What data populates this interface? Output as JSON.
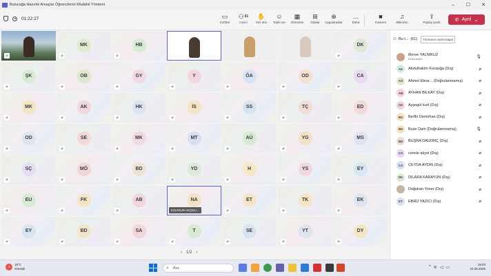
{
  "window": {
    "title": "Bulucağa Hazırlık Amaçlar Öğrencilerin Müdahil Yöntemi"
  },
  "toolbar": {
    "timer": "01:22:27",
    "buttons": [
      {
        "label": "Sohbet",
        "icon": "chat-icon"
      },
      {
        "label": "Kişiler",
        "icon": "people-icon",
        "count": "61"
      },
      {
        "label": "Söz alın",
        "icon": "raise-hand-icon"
      },
      {
        "label": "Tepki ver",
        "icon": "react-icon"
      },
      {
        "label": "Görünüm",
        "icon": "view-icon"
      },
      {
        "label": "Odalar",
        "icon": "rooms-icon"
      },
      {
        "label": "Uygulamalar",
        "icon": "apps-icon"
      },
      {
        "label": "Daha",
        "icon": "more-icon"
      },
      {
        "label": "Kamera",
        "icon": "camera-icon"
      },
      {
        "label": "Mikrofon",
        "icon": "mic-icon"
      },
      {
        "label": "Paylaş içerik",
        "icon": "share-icon"
      }
    ],
    "leave_label": "Ayrıl"
  },
  "grid": {
    "tiles": [
      {
        "initials": "MK",
        "color": "#dfead0"
      },
      {
        "initials": "HB",
        "color": "#d6ebd4"
      },
      {
        "initials": "DK",
        "color": "#dbe9d6"
      },
      {
        "initials": "ŞK",
        "color": "#d8ecd4"
      },
      {
        "initials": "OB",
        "color": "#dfe8cc"
      },
      {
        "initials": "GY",
        "color": "#f2d9e4"
      },
      {
        "initials": "Y",
        "color": "#f4d6df"
      },
      {
        "initials": "ÖA",
        "color": "#d7e3f4"
      },
      {
        "initials": "OD",
        "color": "#f3e0cf"
      },
      {
        "initials": "CA",
        "color": "#ead9f2"
      },
      {
        "initials": "MK",
        "color": "#f4e6c4"
      },
      {
        "initials": "AK",
        "color": "#f2d6dc"
      },
      {
        "initials": "HK",
        "color": "#dde3f3"
      },
      {
        "initials": "İS",
        "color": "#f6e6c6"
      },
      {
        "initials": "SS",
        "color": "#d7e2f3"
      },
      {
        "initials": "TÇ",
        "color": "#f3dcd4"
      },
      {
        "initials": "ED",
        "color": "#f3d8dc"
      },
      {
        "initials": "OD",
        "color": "#dde5ee"
      },
      {
        "initials": "SE",
        "color": "#f4dad6"
      },
      {
        "initials": "MK",
        "color": "#f0d9e2"
      },
      {
        "initials": "MT",
        "color": "#d6e0f3"
      },
      {
        "initials": "AÜ",
        "color": "#d8ead6"
      },
      {
        "initials": "YG",
        "color": "#f4e2c8"
      },
      {
        "initials": "MS",
        "color": "#e0e4f2"
      },
      {
        "initials": "SÇ",
        "color": "#e6dcf3"
      },
      {
        "initials": "MÖ",
        "color": "#f2d6d8"
      },
      {
        "initials": "BD",
        "color": "#eee2d2"
      },
      {
        "initials": "YD",
        "color": "#dceadb"
      },
      {
        "initials": "H",
        "color": "#f5e8c6"
      },
      {
        "initials": "YS",
        "color": "#f2d7e0"
      },
      {
        "initials": "EY",
        "color": "#d8e6f3"
      },
      {
        "initials": "EU",
        "color": "#d7ead6"
      },
      {
        "initials": "FK",
        "color": "#f5e4c6"
      },
      {
        "initials": "AB",
        "color": "#f1d6dd"
      },
      {
        "initials": "NA",
        "color": "#f4e2c6"
      },
      {
        "initials": "ET",
        "color": "#f4e4c8"
      },
      {
        "initials": "TK",
        "color": "#f5e6c6"
      },
      {
        "initials": "EK",
        "color": "#dce3f2"
      },
      {
        "initials": "EY",
        "color": "#d7e6f3"
      },
      {
        "initials": "BD",
        "color": "#f4e4c8"
      },
      {
        "initials": "SA",
        "color": "#f2d6dc"
      },
      {
        "initials": "T",
        "color": "#d9ead4"
      },
      {
        "initials": "SE",
        "color": "#d8e4f3"
      },
      {
        "initials": "YT",
        "color": "#dde4f2"
      },
      {
        "initials": "DY",
        "color": "#f5e6c6"
      }
    ],
    "speaking_name": "KISANUR AKÇELI...",
    "page": "1/2"
  },
  "panel": {
    "title": "Bu t...",
    "count": "(61)",
    "search_label": "Tümünün sesini kapat",
    "participants": [
      {
        "initials": "",
        "name": "Merve YALNIKUZ",
        "sub": "Düzenleyici",
        "color": "#c9a48a",
        "mic": "on"
      },
      {
        "initials": "AK",
        "name": "Abdulhakim Kocaoğa (Dış)",
        "sub": "",
        "color": "#d6ebe7",
        "mic": "off"
      },
      {
        "initials": "AÖ",
        "name": "Ahmet Ebrar... (Doğrulanmamış)",
        "sub": "",
        "color": "#dfe9cf",
        "mic": "off"
      },
      {
        "initials": "AB",
        "name": "AYHAN BİLKAY (Dış)",
        "sub": "",
        "color": "#f3d3da",
        "mic": "off"
      },
      {
        "initials": "AK",
        "name": "Ayşegül kurt (Dış)",
        "sub": "",
        "color": "#f1d3dc",
        "mic": "off"
      },
      {
        "initials": "BD",
        "name": "Berfin Demirhan (Dış)",
        "sub": "",
        "color": "#f5e2c4",
        "mic": "off"
      },
      {
        "initials": "BD",
        "name": "Buse Dam (Doğrulanmamış)",
        "sub": "",
        "color": "#f5e2c4",
        "mic": "on"
      },
      {
        "initials": "BD",
        "name": "BÜŞRA DALKIRÇ (Dış)",
        "sub": "",
        "color": "#ebdcd3",
        "mic": "off"
      },
      {
        "initials": "CA",
        "name": "cemile akyol (Dış)",
        "sub": "",
        "color": "#e3d9f2",
        "mic": "off"
      },
      {
        "initials": "CA",
        "name": "CEYDA AYDIN (Dış)",
        "sub": "",
        "color": "#d6e2f4",
        "mic": "off"
      },
      {
        "initials": "DK",
        "name": "DİLARA KARAYUN (Dış)",
        "sub": "",
        "color": "#dbe8d4",
        "mic": "off"
      },
      {
        "initials": "",
        "name": "Doğukan Yoner (Dış)",
        "sub": "",
        "color": "#c3b7a8",
        "mic": "off"
      },
      {
        "initials": "EY",
        "name": "EBRU YAZICI (Dış)",
        "sub": "",
        "color": "#dce2f4",
        "mic": "off"
      }
    ]
  },
  "taskbar": {
    "weather_temp": "19°C",
    "weather_desc": "Güneşli",
    "search_placeholder": "Ara",
    "time": "19:03",
    "date": "22.05.2025"
  }
}
